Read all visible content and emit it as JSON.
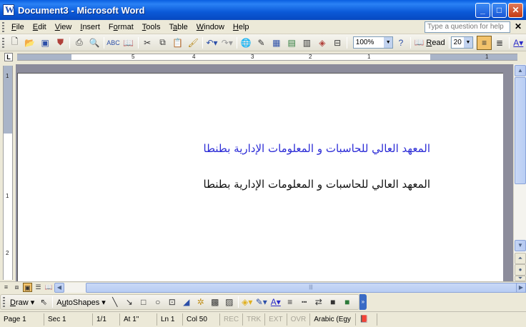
{
  "window": {
    "title": "Document3 - Microsoft Word",
    "buttons": [
      "_",
      "□",
      "✕"
    ]
  },
  "menubar": {
    "items": [
      {
        "u": "F",
        "rest": "ile"
      },
      {
        "u": "E",
        "rest": "dit"
      },
      {
        "u": "V",
        "rest": "iew"
      },
      {
        "u": "I",
        "rest": "nsert"
      },
      {
        "pre": "F",
        "u": "o",
        "rest": "rmat"
      },
      {
        "u": "T",
        "rest": "ools"
      },
      {
        "pre": "T",
        "u": "a",
        "rest": "ble"
      },
      {
        "u": "W",
        "rest": "indow"
      },
      {
        "u": "H",
        "rest": "elp"
      }
    ],
    "help_placeholder": "Type a question for help",
    "close": "✕"
  },
  "toolbar": {
    "zoom": "100%",
    "read_label_u": "R",
    "read_label_rest": "ead",
    "font_size": "20"
  },
  "document": {
    "line1": "المعهد العالي للحاسبات و المعلومات الإدارية بطنطا",
    "line2": "المعهد العالي للحاسبات و المعلومات الإدارية بطنطا",
    "line1_color": "#2b2bd6",
    "line2_color": "#111111"
  },
  "ruler": {
    "numbers": [
      "5",
      "4",
      "3",
      "2",
      "1",
      "1"
    ],
    "vnumbers": [
      "1",
      "1",
      "2"
    ]
  },
  "drawbar": {
    "draw_u": "D",
    "draw_rest": "raw",
    "autoshapes_pre": "A",
    "autoshapes_u": "u",
    "autoshapes_rest": "toShapes"
  },
  "statusbar": {
    "page": "Page  1",
    "sec": "Sec  1",
    "pages": "1/1",
    "at": "At  1\"",
    "ln": "Ln  1",
    "col": "Col  50",
    "rec": "REC",
    "trk": "TRK",
    "ext": "EXT",
    "ovr": "OVR",
    "lang": "Arabic (Egy"
  }
}
